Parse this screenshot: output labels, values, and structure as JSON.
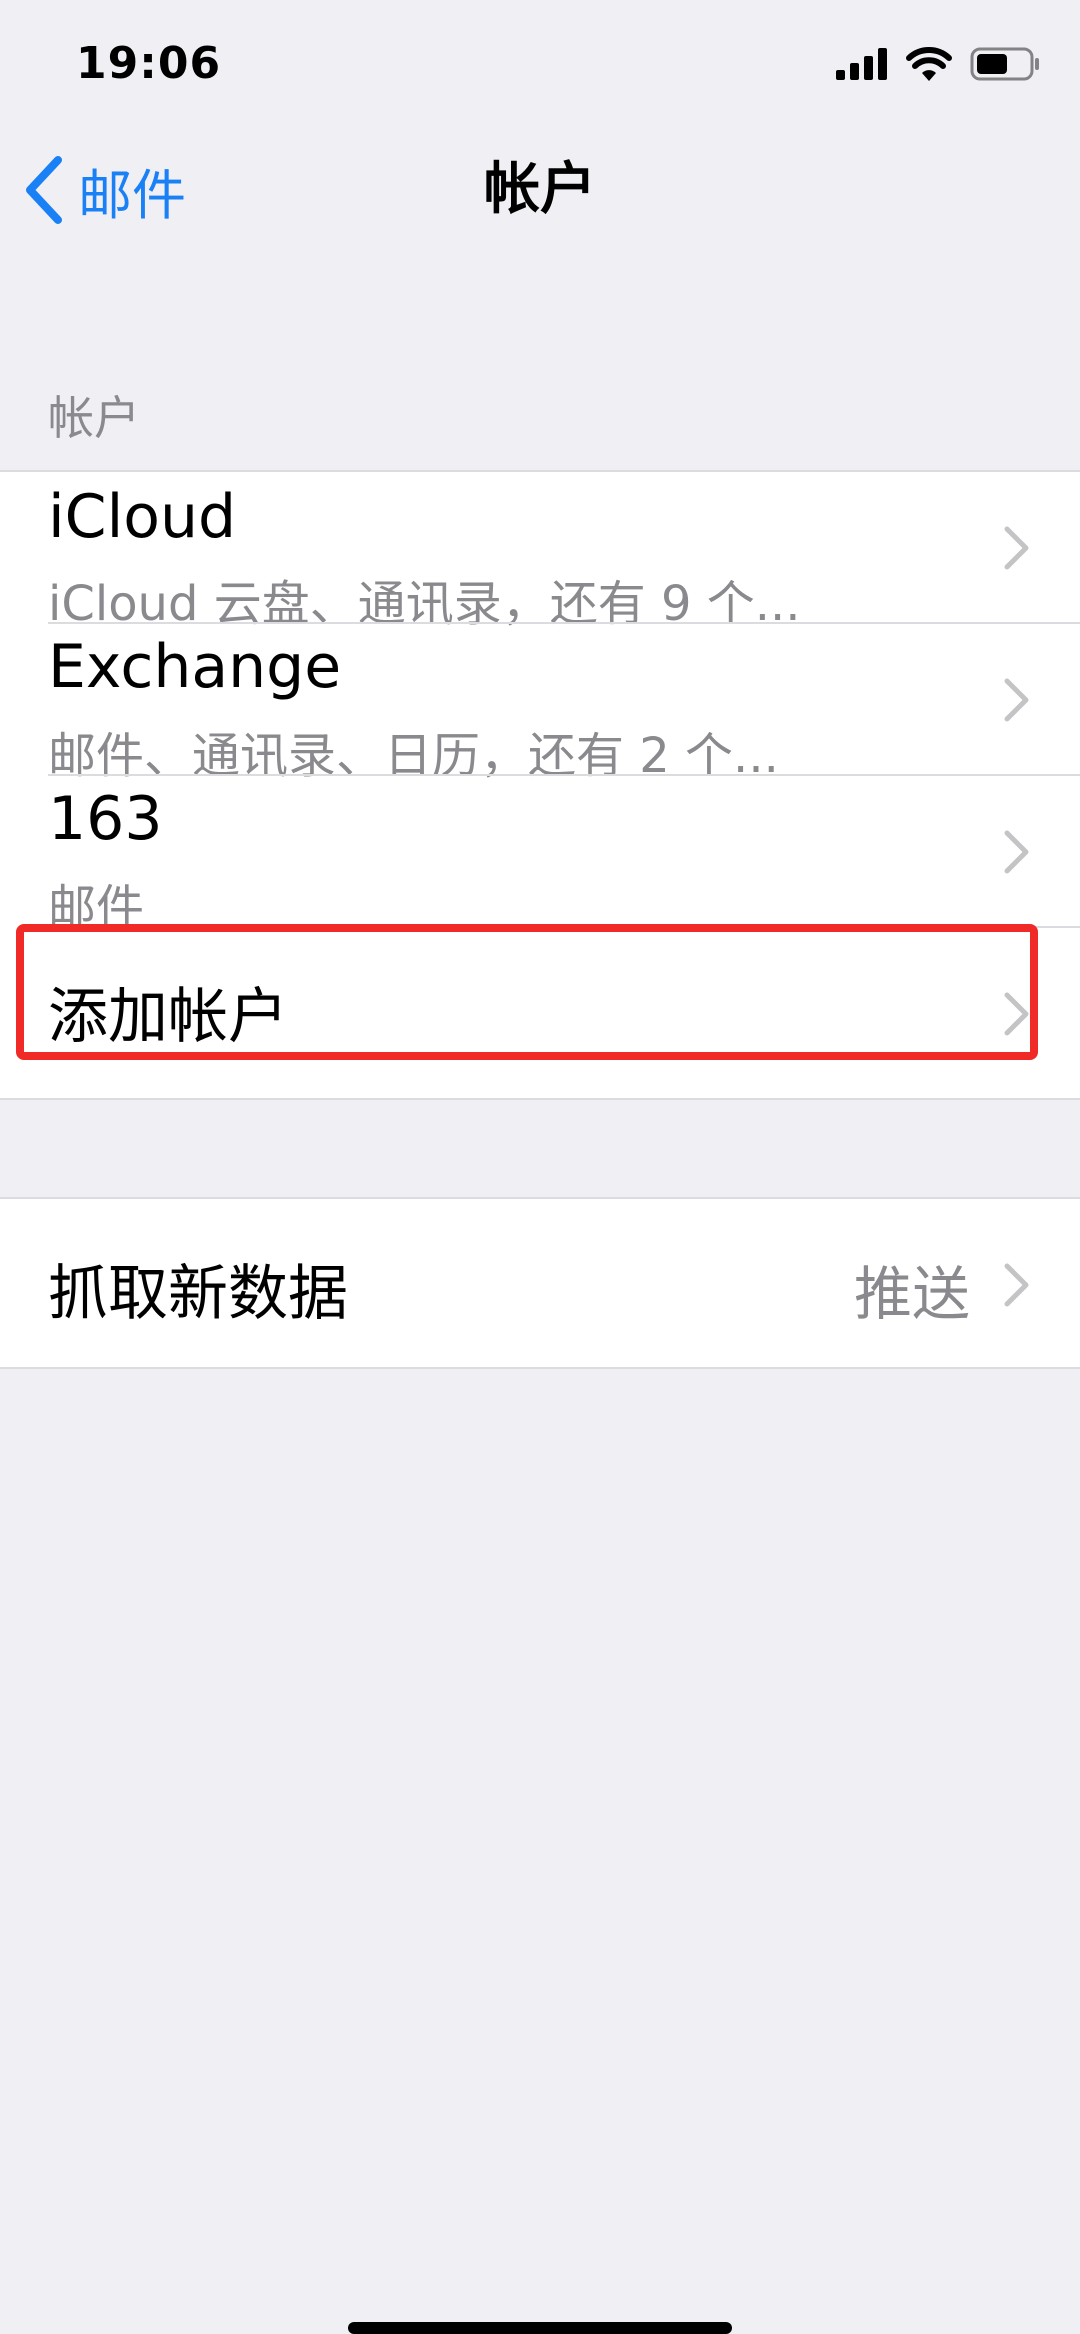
{
  "status_bar": {
    "time": "19:06",
    "icons": [
      "signal-icon",
      "wifi-icon",
      "battery-icon"
    ]
  },
  "nav": {
    "back_label": "邮件",
    "title": "帐户"
  },
  "accounts_section": {
    "header": "帐户",
    "items": [
      {
        "title": "iCloud",
        "subtitle": "iCloud 云盘、通讯录，还有 9 个..."
      },
      {
        "title": "Exchange",
        "subtitle": "邮件、通讯录、日历，还有 2 个..."
      },
      {
        "title": "163",
        "subtitle": "邮件"
      }
    ],
    "add_account": "添加帐户"
  },
  "fetch_section": {
    "label": "抓取新数据",
    "value": "推送"
  },
  "colors": {
    "accent": "#1a80f5",
    "highlight": "#f02a26",
    "secondary_text": "#8a8a8e",
    "background": "#efeff4"
  }
}
